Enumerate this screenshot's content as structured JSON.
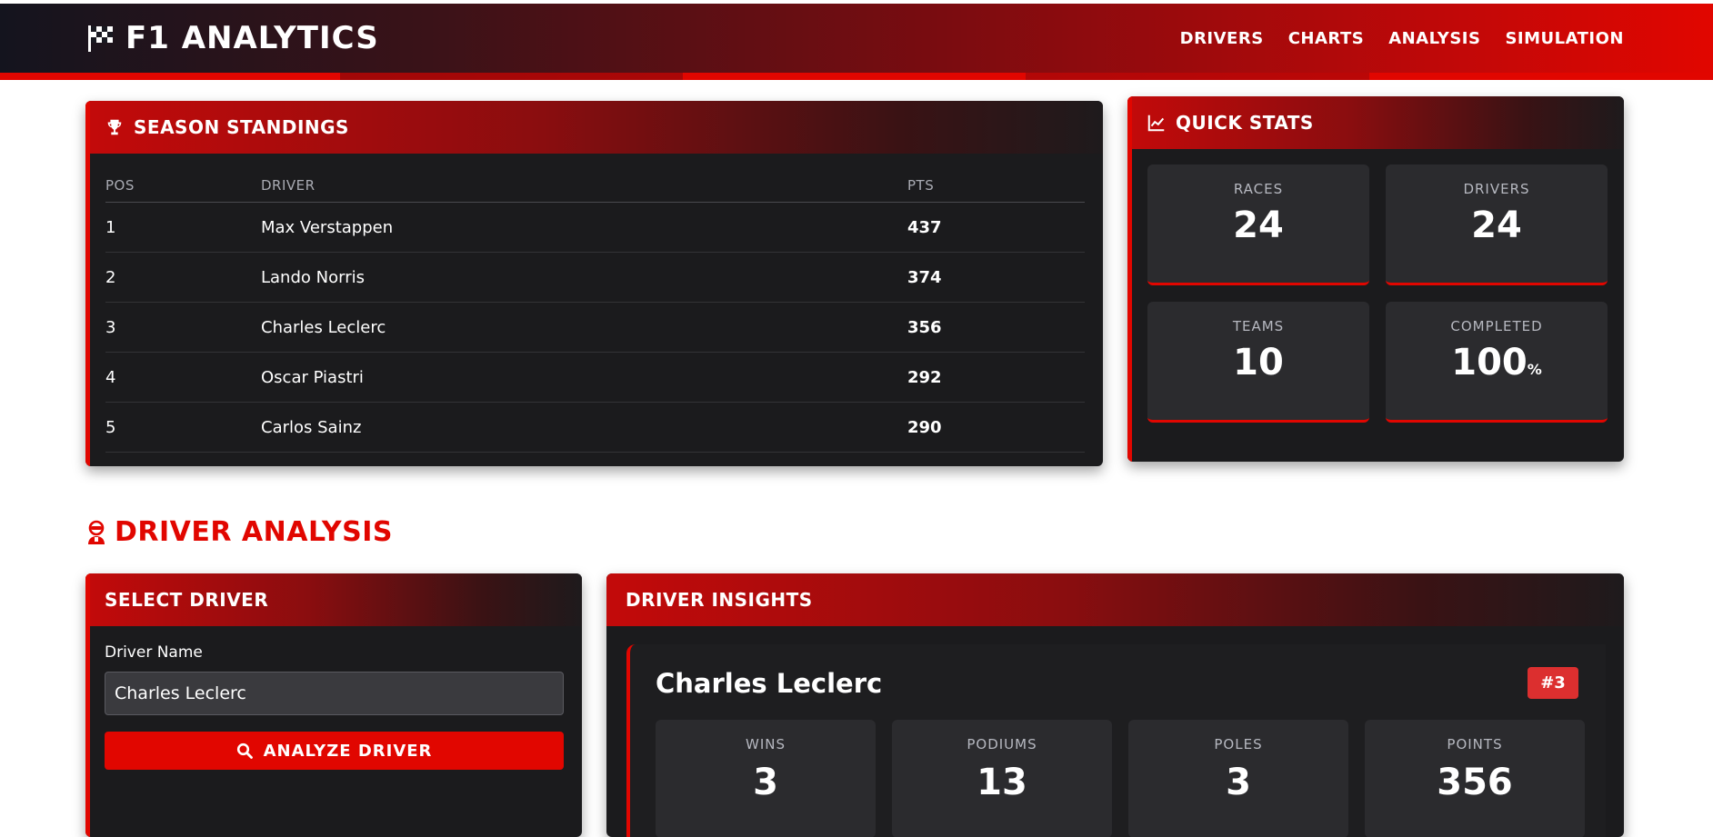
{
  "navbar": {
    "brand": "F1 ANALYTICS",
    "brand_icon": "checkered-flag-icon",
    "links": [
      "DRIVERS",
      "CHARTS",
      "ANALYSIS",
      "SIMULATION"
    ]
  },
  "colors": {
    "accent": "#e10600",
    "panel": "#1b1b1d",
    "tile": "#2b2b2e"
  },
  "standings": {
    "title": "SEASON STANDINGS",
    "icon": "trophy-icon",
    "columns": [
      "POS",
      "DRIVER",
      "PTS"
    ],
    "rows": [
      {
        "pos": "1",
        "driver": "Max Verstappen",
        "pts": "437"
      },
      {
        "pos": "2",
        "driver": "Lando Norris",
        "pts": "374"
      },
      {
        "pos": "3",
        "driver": "Charles Leclerc",
        "pts": "356"
      },
      {
        "pos": "4",
        "driver": "Oscar Piastri",
        "pts": "292"
      },
      {
        "pos": "5",
        "driver": "Carlos Sainz",
        "pts": "290"
      }
    ]
  },
  "quick_stats": {
    "title": "QUICK STATS",
    "icon": "line-chart-icon",
    "tiles": [
      {
        "label": "RACES",
        "value": "24",
        "unit": ""
      },
      {
        "label": "DRIVERS",
        "value": "24",
        "unit": ""
      },
      {
        "label": "TEAMS",
        "value": "10",
        "unit": ""
      },
      {
        "label": "COMPLETED",
        "value": "100",
        "unit": "%"
      }
    ]
  },
  "driver_analysis": {
    "heading": "DRIVER ANALYSIS",
    "icon": "driver-helmet-icon"
  },
  "select_driver": {
    "title": "SELECT DRIVER",
    "field_label": "Driver Name",
    "field_value": "Charles Leclerc",
    "button_label": "ANALYZE DRIVER",
    "button_icon": "search-icon"
  },
  "insights": {
    "title": "DRIVER INSIGHTS",
    "driver_name": "Charles Leclerc",
    "badge": "#3",
    "stats": [
      {
        "label": "WINS",
        "value": "3"
      },
      {
        "label": "PODIUMS",
        "value": "13"
      },
      {
        "label": "POLES",
        "value": "3"
      },
      {
        "label": "POINTS",
        "value": "356"
      }
    ]
  }
}
